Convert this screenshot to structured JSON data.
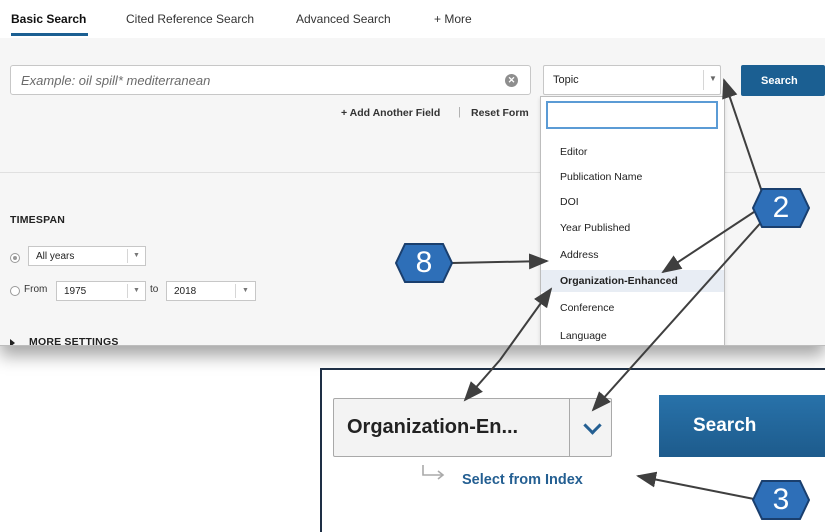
{
  "tabs": [
    {
      "label": "Basic Search",
      "active": true
    },
    {
      "label": "Cited Reference Search",
      "active": false
    },
    {
      "label": "Advanced Search",
      "active": false
    },
    {
      "label": "+ More",
      "active": false
    }
  ],
  "search": {
    "placeholder": "Example: oil spill* mediterranean",
    "field_value": "Topic",
    "button_label": "Search",
    "add_field_label": "+ Add Another Field",
    "separator": "|",
    "reset_label": "Reset Form"
  },
  "timespan": {
    "title": "TIMESPAN",
    "all_years_label": "All years",
    "from_label": "From",
    "from_value": "1975",
    "to_label": "to",
    "to_value": "2018",
    "selected_option": "All years"
  },
  "more_settings_label": "MORE SETTINGS",
  "dropdown": {
    "search_value": "",
    "items": [
      {
        "label": "Editor",
        "highlighted": false
      },
      {
        "label": "Publication Name",
        "highlighted": false
      },
      {
        "label": "DOI",
        "highlighted": false
      },
      {
        "label": "Year Published",
        "highlighted": false
      },
      {
        "label": "Address",
        "highlighted": false
      },
      {
        "label": "Organization-Enhanced",
        "highlighted": true
      },
      {
        "label": "Conference",
        "highlighted": false
      },
      {
        "label": "Language",
        "highlighted": false
      }
    ]
  },
  "inset": {
    "field_value": "Organization-En...",
    "button_label": "Search",
    "index_link": "Select from Index"
  },
  "callouts": [
    {
      "number": "8"
    },
    {
      "number": "2"
    },
    {
      "number": "3"
    }
  ],
  "colors": {
    "accent": "#1b5f92",
    "callout_fill": "#2e6fb8",
    "callout_stroke": "#1a3f6e",
    "dropdown_highlight": "#e8edf4"
  }
}
